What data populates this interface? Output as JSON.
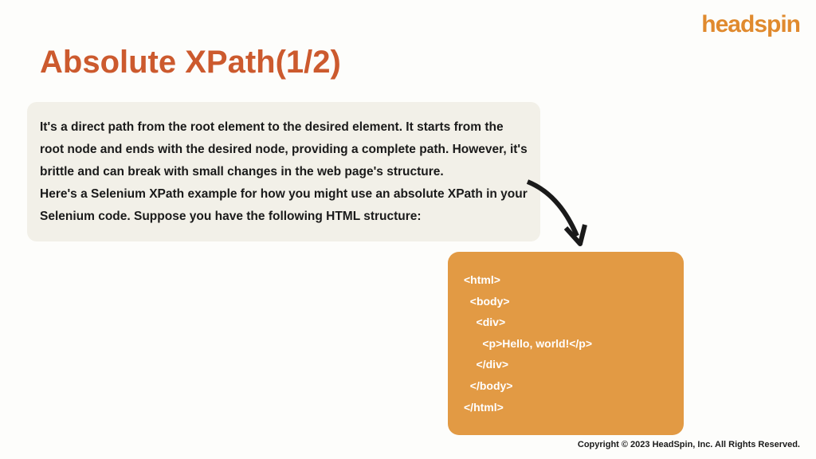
{
  "brand": {
    "logo_text": "headspin"
  },
  "slide": {
    "title": "Absolute XPath(1/2)",
    "description": "It's a direct path from the root element to the desired element. It starts from the root node and ends with the desired node, providing a complete path. However, it's brittle and can break with small changes in the web page's structure.\nHere's a Selenium XPath example for how you might use an absolute XPath in your Selenium code. Suppose you have the following HTML structure:"
  },
  "code": {
    "lines": [
      "<html>",
      "  <body>",
      "    <div>",
      "      <p>Hello, world!</p>",
      "    </div>",
      "  </body>",
      "</html>"
    ]
  },
  "footer": {
    "copyright": "Copyright © 2023 HeadSpin, Inc. All Rights Reserved."
  }
}
